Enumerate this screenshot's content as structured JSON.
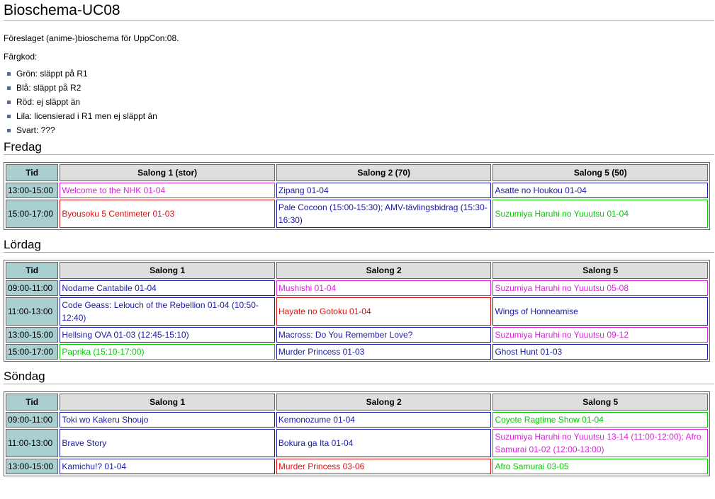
{
  "title": "Bioschema-UC08",
  "intro": "Föreslaget (anime-)bioschema för UppCon:08.",
  "color_label": "Färgkod:",
  "legend": [
    "Grön: släppt på R1",
    "Blå: släppt på R2",
    "Röd: ej släppt än",
    "Lila: licensierad i R1 men ej släppt än",
    "Svart: ???"
  ],
  "colors": {
    "green": "#00cc00",
    "blue": "#1a1aa6",
    "red": "#dd1111",
    "purple": "#dd22dd",
    "time_bg": "#a9cfd0",
    "header_bg": "#dedede"
  },
  "days": [
    {
      "name": "Fredag",
      "headers": [
        "Tid",
        "Salong 1 (stor)",
        "Salong 2 (70)",
        "Salong 5 (50)"
      ],
      "rows": [
        {
          "time": "13:00-15:00",
          "cells": [
            {
              "text": "Welcome to the NHK 01-04",
              "color": "p"
            },
            {
              "text": "Zipang 01-04",
              "color": "b"
            },
            {
              "text": "Asatte no Houkou 01-04",
              "color": "b"
            }
          ]
        },
        {
          "time": "15:00-17:00",
          "cells": [
            {
              "text": "Byousoku 5 Centimeter 01-03",
              "color": "r"
            },
            {
              "text": "Pale Cocoon (15:00-15:30); AMV-tävlingsbidrag (15:30-16:30)",
              "color": "b"
            },
            {
              "text": "Suzumiya Haruhi no Yuuutsu 01-04",
              "color": "g"
            }
          ]
        }
      ]
    },
    {
      "name": "Lördag",
      "headers": [
        "Tid",
        "Salong 1",
        "Salong 2",
        "Salong 5"
      ],
      "rows": [
        {
          "time": "09:00-11:00",
          "cells": [
            {
              "text": "Nodame Cantabile 01-04",
              "color": "b"
            },
            {
              "text": "Mushishi 01-04",
              "color": "p"
            },
            {
              "text": "Suzumiya Haruhi no Yuuutsu 05-08",
              "color": "p"
            }
          ]
        },
        {
          "time": "11:00-13:00",
          "cells": [
            {
              "text": "Code Geass: Lelouch of the Rebellion 01-04 (10:50-12:40)",
              "color": "b"
            },
            {
              "text": "Hayate no Gotoku 01-04",
              "color": "r"
            },
            {
              "text": "Wings of Honneamise",
              "color": "b"
            }
          ]
        },
        {
          "time": "13:00-15:00",
          "cells": [
            {
              "text": "Hellsing OVA 01-03 (12:45-15:10)",
              "color": "b"
            },
            {
              "text": "Macross: Do You Remember Love?",
              "color": "b"
            },
            {
              "text": "Suzumiya Haruhi no Yuuutsu 09-12",
              "color": "p"
            }
          ]
        },
        {
          "time": "15:00-17:00",
          "cells": [
            {
              "text": "Paprika (15:10-17:00)",
              "color": "g"
            },
            {
              "text": "Murder Princess 01-03",
              "color": "b"
            },
            {
              "text": "Ghost Hunt 01-03",
              "color": "b"
            }
          ]
        }
      ]
    },
    {
      "name": "Söndag",
      "headers": [
        "Tid",
        "Salong 1",
        "Salong 2",
        "Salong 5"
      ],
      "rows": [
        {
          "time": "09:00-11:00",
          "cells": [
            {
              "text": "Toki wo Kakeru Shoujo",
              "color": "b"
            },
            {
              "text": "Kemonozume 01-04",
              "color": "b"
            },
            {
              "text": "Coyote Ragtime Show 01-04",
              "color": "g"
            }
          ]
        },
        {
          "time": "11:00-13:00",
          "cells": [
            {
              "text": "Brave Story",
              "color": "b"
            },
            {
              "text": "Bokura ga Ita 01-04",
              "color": "b"
            },
            {
              "text": "Suzumiya Haruhi no Yuuutsu 13-14 (11:00-12:00); Afro Samurai 01-02 (12:00-13:00)",
              "color": "p"
            }
          ]
        },
        {
          "time": "13:00-15:00",
          "cells": [
            {
              "text": "Kamichu!? 01-04",
              "color": "b"
            },
            {
              "text": "Murder Princess 03-06",
              "color": "r"
            },
            {
              "text": "Afro Samurai 03-05",
              "color": "g"
            }
          ]
        }
      ]
    }
  ]
}
